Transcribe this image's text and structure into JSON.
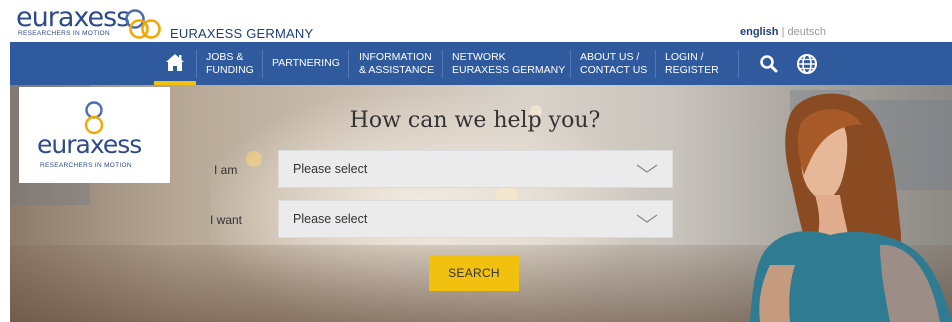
{
  "brand": {
    "logo_word": "euraxess",
    "logo_tagline": "RESEARCHERS IN MOTION",
    "site_title": "EURAXESS GERMANY",
    "colors": {
      "navy": "#2f5a9e",
      "accent_yellow": "#f2c00e",
      "ring_blue": "#2d4a8a",
      "ring_orange": "#f3a800"
    }
  },
  "language": {
    "active": "english",
    "separator": "|",
    "other": "deutsch"
  },
  "nav": {
    "home_icon": "home-icon",
    "items": [
      {
        "label": "JOBS &\nFUNDING"
      },
      {
        "label": "PARTNERING"
      },
      {
        "label": "INFORMATION\n& ASSISTANCE"
      },
      {
        "label": "NETWORK\nEURAXESS GERMANY"
      },
      {
        "label": "ABOUT US /\nCONTACT US"
      },
      {
        "label": "LOGIN /\nREGISTER"
      }
    ],
    "search_icon": "search-icon",
    "globe_icon": "globe-icon"
  },
  "hero": {
    "headline": "How can we help you?",
    "form": {
      "i_am_label": "I am",
      "i_am_value": "Please select",
      "i_want_label": "I want",
      "i_want_value": "Please select",
      "search_label": "SEARCH"
    }
  }
}
